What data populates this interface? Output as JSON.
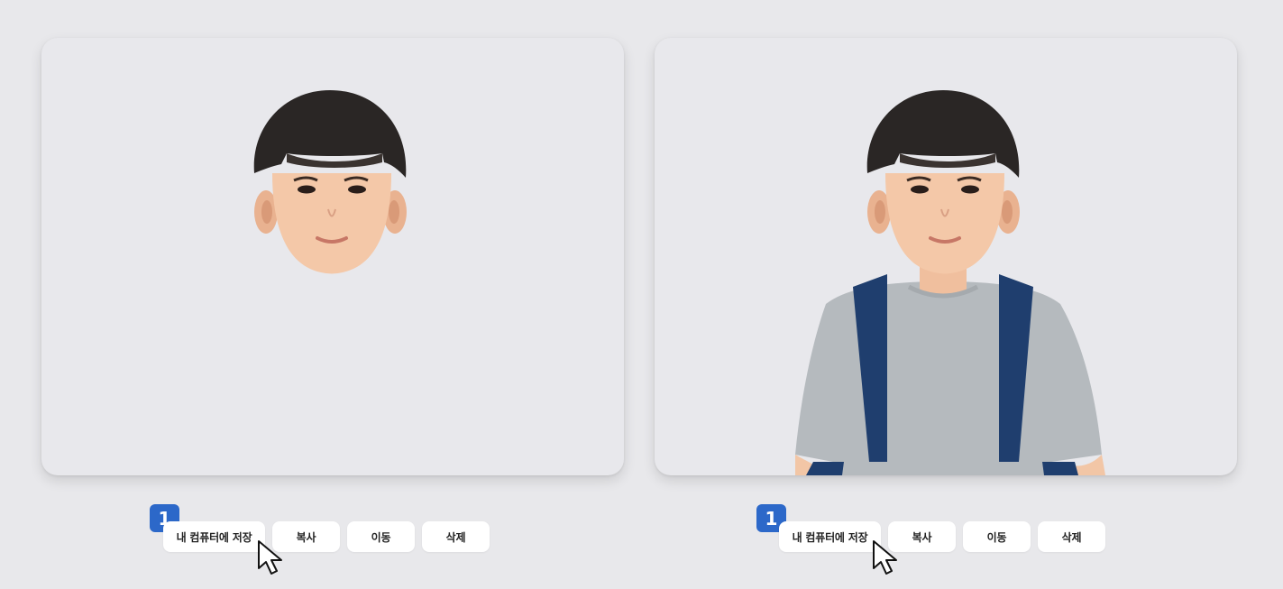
{
  "panels": [
    {
      "id": "left",
      "content": "cut-out child face only",
      "step_badge": "1",
      "actions": {
        "save": "내 컴퓨터에 저장",
        "copy": "복사",
        "move": "이동",
        "delete": "삭제"
      }
    },
    {
      "id": "right",
      "content": "cut-out child upper body with backpack",
      "step_badge": "1",
      "actions": {
        "save": "내 컴퓨터에 저장",
        "copy": "복사",
        "move": "이동",
        "delete": "삭제"
      }
    }
  ],
  "colors": {
    "page_background": "#e8e8eb",
    "panel_background": "#e8e8ec",
    "badge": "#2c68c9",
    "button": "#ffffff"
  },
  "icons": {
    "cursor": "cursor-arrow-icon"
  }
}
